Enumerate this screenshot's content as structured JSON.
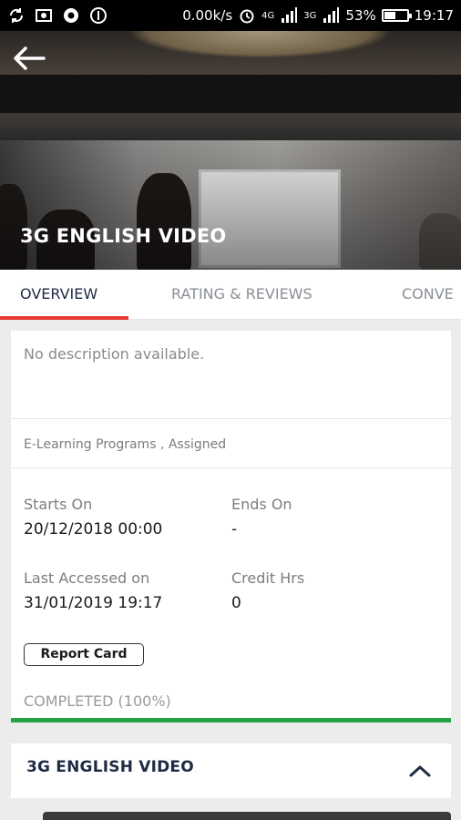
{
  "status_bar": {
    "speed": "0.00k/s",
    "net1": "4G",
    "net2": "3G",
    "battery": "53%",
    "battery_level": 0.53,
    "time": "19:17"
  },
  "hero": {
    "title": "3G ENGLISH VIDEO"
  },
  "tabs": [
    {
      "label": "OVERVIEW",
      "active": true
    },
    {
      "label": "RATING & REVIEWS",
      "active": false
    },
    {
      "label": "CONVE",
      "active": false
    }
  ],
  "overview": {
    "description": "No description available.",
    "category": "E-Learning Programs , Assigned",
    "starts_on_label": "Starts On",
    "starts_on_value": "20/12/2018 00:00",
    "ends_on_label": "Ends On",
    "ends_on_value": "-",
    "last_accessed_label": "Last Accessed on",
    "last_accessed_value": "31/01/2019 19:17",
    "credit_hrs_label": "Credit Hrs",
    "credit_hrs_value": "0",
    "report_card_label": "Report Card",
    "completion_text": "COMPLETED (100%)",
    "completion_fraction": 1.0
  },
  "section": {
    "title": "3G ENGLISH VIDEO",
    "expanded": true
  },
  "colors": {
    "accent_tab": "#e53935",
    "progress": "#22a447",
    "title_text": "#1f2a44"
  }
}
